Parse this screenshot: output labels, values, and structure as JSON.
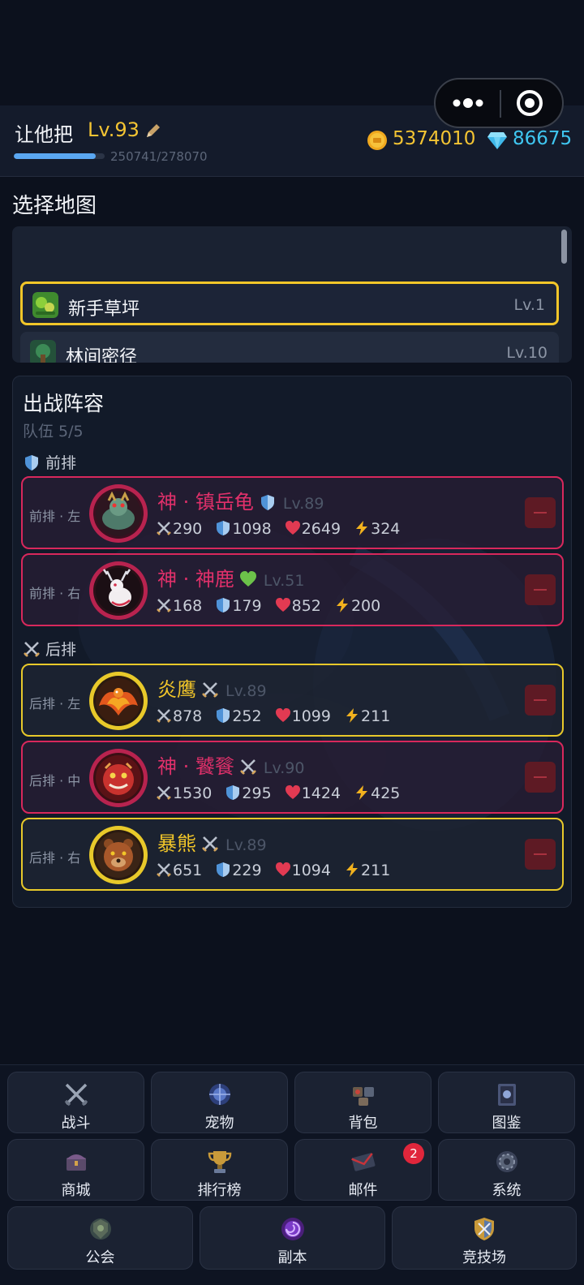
{
  "player": {
    "name": "让他把",
    "level": "Lv.93",
    "xp_text": "250741/278070",
    "xp_fraction": 0.9017,
    "gold": "5374010",
    "gems": "86675"
  },
  "map_section": {
    "title": "选择地图",
    "items": [
      {
        "name": "新手草坪",
        "level": "Lv.1",
        "selected": true
      },
      {
        "name": "林间密径",
        "level": "Lv.10",
        "selected": false
      }
    ]
  },
  "lineup": {
    "title": "出战阵容",
    "team_count": "队伍 5/5",
    "front_label": "前排",
    "back_label": "后排",
    "pets": [
      {
        "slot": "前排 · 左",
        "name": "神 · 镇岳龟",
        "level": "Lv.89",
        "rarity": "red",
        "badge": "shield-icon",
        "attack": "290",
        "defense": "1098",
        "hp": "2649",
        "speed": "324"
      },
      {
        "slot": "前排 · 右",
        "name": "神 · 神鹿",
        "level": "Lv.51",
        "rarity": "red",
        "badge": "heart-icon",
        "attack": "168",
        "defense": "179",
        "hp": "852",
        "speed": "200"
      },
      {
        "slot": "后排 · 左",
        "name": "炎鹰",
        "level": "Lv.89",
        "rarity": "gold",
        "badge": "swords-icon",
        "attack": "878",
        "defense": "252",
        "hp": "1099",
        "speed": "211"
      },
      {
        "slot": "后排 · 中",
        "name": "神 · 饕餮",
        "level": "Lv.90",
        "rarity": "red",
        "badge": "swords-icon",
        "attack": "1530",
        "defense": "295",
        "hp": "1424",
        "speed": "425"
      },
      {
        "slot": "后排 · 右",
        "name": "暴熊",
        "level": "Lv.89",
        "rarity": "gold",
        "badge": "swords-icon",
        "attack": "651",
        "defense": "229",
        "hp": "1094",
        "speed": "211"
      }
    ]
  },
  "nav": {
    "battle": "战斗",
    "pets": "宠物",
    "bag": "背包",
    "codex": "图鉴",
    "shop": "商城",
    "ranking": "排行榜",
    "mail": "邮件",
    "mail_badge": "2",
    "system": "系统",
    "guild": "公会",
    "dungeon": "副本",
    "arena": "竞技场"
  },
  "colors": {
    "accent_gold": "#f3c433",
    "gem_blue": "#3fc6f0",
    "rarity_red": "#d8285c",
    "rarity_gold": "#e8c92a",
    "xp_blue": "#5aa7f2"
  }
}
